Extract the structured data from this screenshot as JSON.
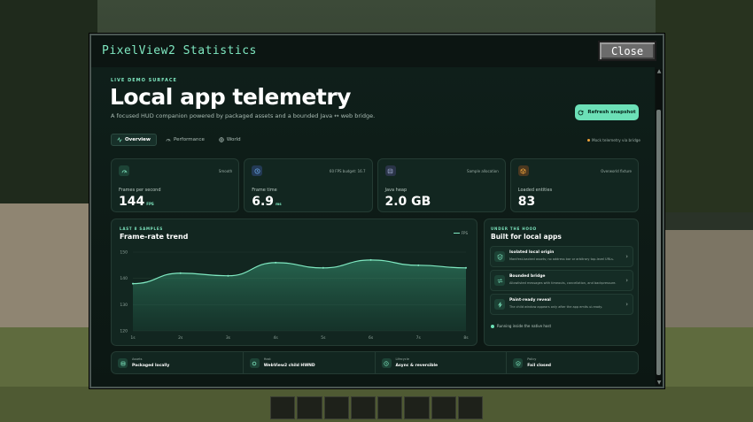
{
  "window": {
    "title": "PixelView2 Statistics",
    "close_label": "Close"
  },
  "hero": {
    "eyebrow": "LIVE DEMO SURFACE",
    "title": "Local app telemetry",
    "subtitle": "A focused HUD companion powered by packaged assets and a bounded Java ↔ web bridge.",
    "refresh_label": "Refresh snapshot"
  },
  "tabs": [
    {
      "label": "Overview",
      "icon": "activity-icon",
      "active": true
    },
    {
      "label": "Performance",
      "icon": "gauge-icon",
      "active": false
    },
    {
      "label": "World",
      "icon": "globe-icon",
      "active": false
    }
  ],
  "mock_note": "Mock telemetry via bridge",
  "cards": [
    {
      "tag": "Smooth",
      "label": "Frames per second",
      "value": "144",
      "unit": "FPS",
      "icon": "gauge-icon",
      "accent": "#7fe8c1"
    },
    {
      "tag": "60 FPS budget: 16.7",
      "label": "Frame time",
      "value": "6.9",
      "unit": "ms",
      "icon": "clock-icon",
      "accent": "#6aa8e8"
    },
    {
      "tag": "Sample allocation",
      "label": "Java heap",
      "value": "2.0 GB",
      "unit": "",
      "icon": "database-icon",
      "accent": "#8b96b8"
    },
    {
      "tag": "Overworld fixture",
      "label": "Loaded entities",
      "value": "83",
      "unit": "",
      "icon": "cube-icon",
      "accent": "#f0a33a"
    }
  ],
  "chart_panel": {
    "eyebrow": "LAST 8 SAMPLES",
    "title": "Frame-rate trend",
    "legend": "FPS"
  },
  "chart_data": {
    "type": "area",
    "categories": [
      "1s",
      "2s",
      "3s",
      "4s",
      "5s",
      "6s",
      "7s",
      "8s"
    ],
    "series": [
      {
        "name": "FPS",
        "values": [
          138,
          142,
          141,
          146,
          144,
          147,
          145,
          144
        ]
      }
    ],
    "ylim": [
      120,
      150
    ],
    "yticks": [
      120,
      130,
      140,
      150
    ],
    "grid": true,
    "legend_position": "top-right"
  },
  "hood": {
    "eyebrow": "UNDER THE HOOD",
    "title": "Built for local apps",
    "items": [
      {
        "name": "Isolated local origin",
        "desc": "Manifest-backed assets; no address bar or arbitrary top-level URLs.",
        "icon": "shield-icon"
      },
      {
        "name": "Bounded bridge",
        "desc": "Allowlisted messages with timeouts, cancellation, and backpressure.",
        "icon": "bridge-icon"
      },
      {
        "name": "Paint-ready reveal",
        "desc": "The child window appears only after the app emits ui.ready.",
        "icon": "bolt-icon"
      }
    ],
    "status": "Running inside the native host"
  },
  "footer": [
    {
      "key": "Assets",
      "value": "Packaged locally",
      "icon": "database-icon"
    },
    {
      "key": "Host",
      "value": "WebView2 child HWND",
      "icon": "cpu-icon"
    },
    {
      "key": "Lifecycle",
      "value": "Async & reversible",
      "icon": "clock-icon"
    },
    {
      "key": "Policy",
      "value": "Fail closed",
      "icon": "shield-icon"
    }
  ]
}
